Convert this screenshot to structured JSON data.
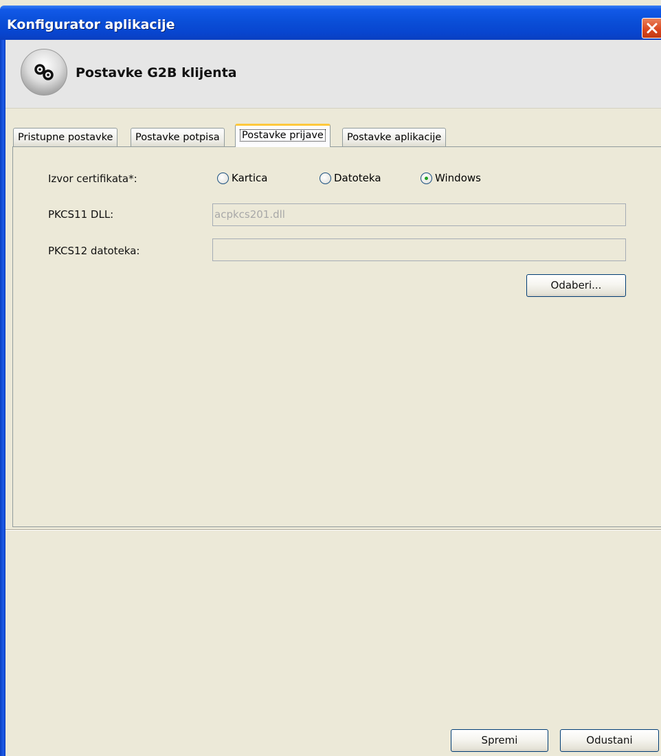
{
  "window": {
    "title": "Konfigurator aplikacije",
    "close_icon": "close-icon"
  },
  "header": {
    "icon": "gears-icon",
    "title": "Postavke G2B klijenta"
  },
  "tabs": [
    {
      "label": "Pristupne postavke",
      "active": false
    },
    {
      "label": "Postavke potpisa",
      "active": false
    },
    {
      "label": "Postavke prijave",
      "active": true
    },
    {
      "label": "Postavke aplikacije",
      "active": false
    }
  ],
  "form": {
    "cert_source": {
      "label": "Izvor certifikata*:",
      "options": [
        {
          "label": "Kartica",
          "checked": false
        },
        {
          "label": "Datoteka",
          "checked": false
        },
        {
          "label": "Windows",
          "checked": true
        }
      ]
    },
    "pkcs11": {
      "label": "PKCS11 DLL:",
      "value": "acpkcs201.dll"
    },
    "pkcs12": {
      "label": "PKCS12 datoteka:",
      "value": ""
    },
    "choose_label": "Odaberi..."
  },
  "footer": {
    "save_label": "Spremi",
    "cancel_label": "Odustani"
  },
  "colors": {
    "titlebar": "#0a4fd8",
    "window_bg": "#ece9d8",
    "active_tab_accent": "#ffc83c",
    "radio_checked": "#21a121"
  }
}
